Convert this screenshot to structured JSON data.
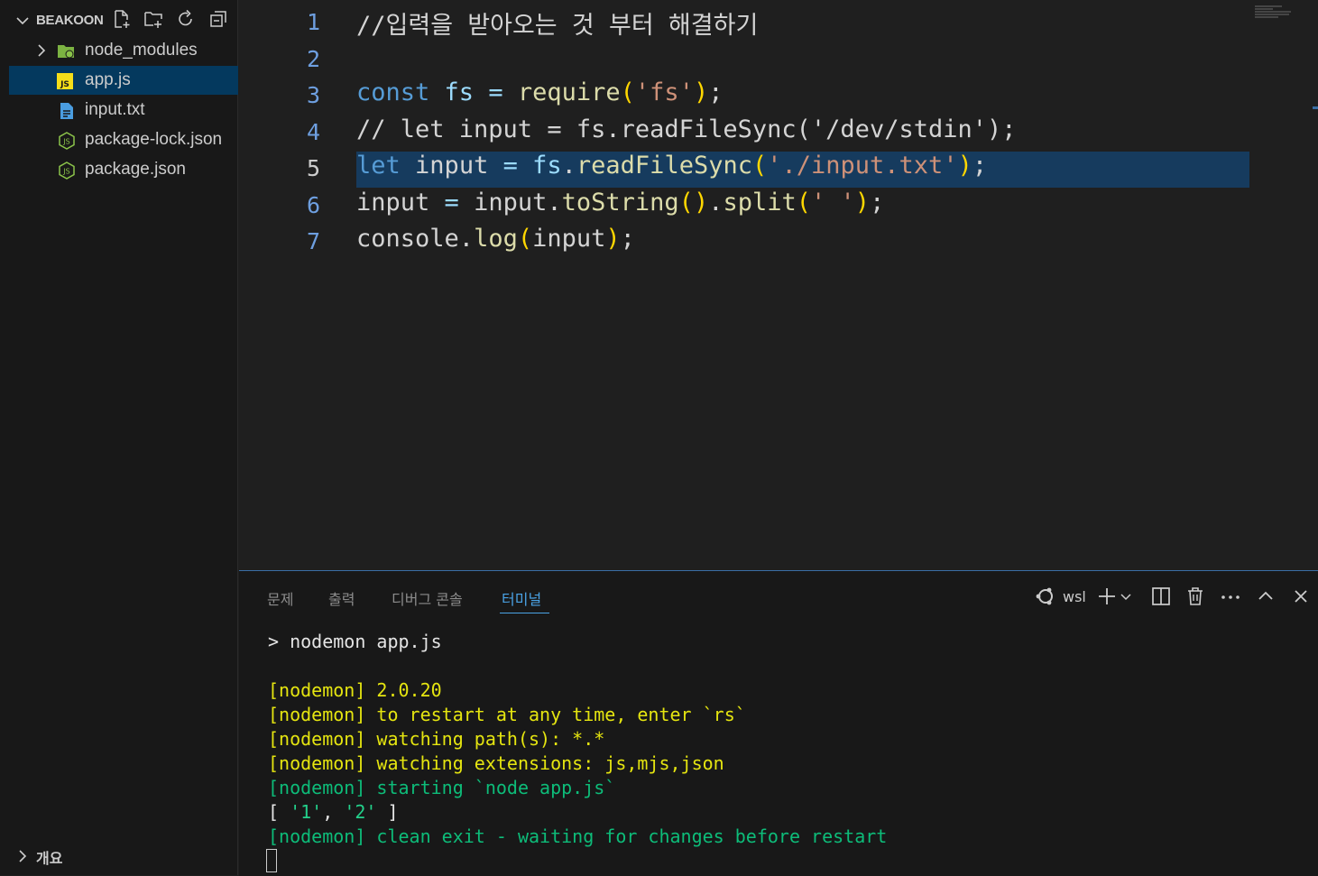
{
  "sidebar": {
    "title": "BEAKOON",
    "items": [
      {
        "label": "node_modules",
        "icon": "folder-node-icon"
      },
      {
        "label": "app.js",
        "icon": "js-file-icon"
      },
      {
        "label": "input.txt",
        "icon": "text-file-icon"
      },
      {
        "label": "package-lock.json",
        "icon": "node-json-icon"
      },
      {
        "label": "package.json",
        "icon": "node-json-icon"
      }
    ],
    "outline_label": "개요"
  },
  "editor": {
    "line_numbers": [
      "1",
      "2",
      "3",
      "4",
      "5",
      "6",
      "7"
    ],
    "lines": [
      "//입력을 받아오는 것 부터 해결하기",
      "",
      "const fs = require('fs');",
      "// let input = fs.readFileSync('/dev/stdin');",
      "let input = fs.readFileSync('./input.txt');",
      "input = input.toString().split(' ');",
      "console.log(input);"
    ],
    "active_line": 5
  },
  "panel": {
    "tabs": [
      "문제",
      "출력",
      "디버그 콘솔",
      "터미널"
    ],
    "active_tab": "터미널",
    "terminal_profile": "wsl",
    "terminal_lines": [
      "> nodemon app.js",
      "",
      "[nodemon] 2.0.20",
      "[nodemon] to restart at any time, enter `rs`",
      "[nodemon] watching path(s): *.*",
      "[nodemon] watching extensions: js,mjs,json",
      "[nodemon] starting `node app.js`",
      "[ '1', '2' ]",
      "[nodemon] clean exit - waiting for changes before restart"
    ]
  },
  "colors": {
    "accent": "#4aa3e6",
    "selection": "#04395e",
    "terminal_yellow": "#e5e510",
    "terminal_green": "#23d18b"
  }
}
